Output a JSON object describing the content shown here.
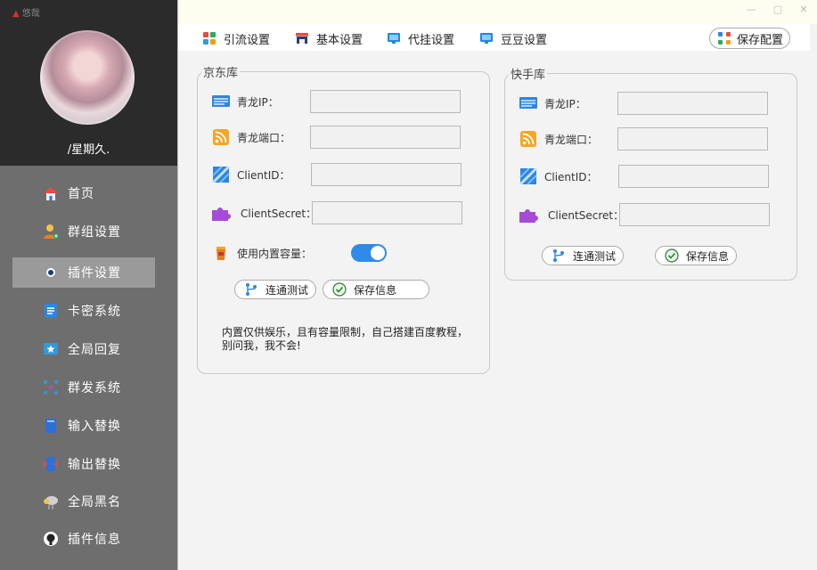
{
  "app": {
    "logo_text": "悠哉"
  },
  "window": {
    "minimize": "—",
    "restore": "▢",
    "close": "✕"
  },
  "profile": {
    "username": "/星期久."
  },
  "sidebar": {
    "items": [
      {
        "label": "首页",
        "icon": "home-icon"
      },
      {
        "label": "群组设置",
        "icon": "group-settings-icon"
      },
      {
        "label": "插件设置",
        "icon": "plugin-settings-icon",
        "active": true
      },
      {
        "label": "卡密系统",
        "icon": "card-key-icon"
      },
      {
        "label": "全局回复",
        "icon": "global-reply-icon"
      },
      {
        "label": "群发系统",
        "icon": "broadcast-icon"
      },
      {
        "label": "输入替换",
        "icon": "input-replace-icon"
      },
      {
        "label": "输出替换",
        "icon": "output-replace-icon"
      },
      {
        "label": "全局黑名",
        "icon": "global-blacklist-icon"
      },
      {
        "label": "插件信息",
        "icon": "github-icon"
      }
    ]
  },
  "tabs": [
    {
      "label": "引流设置",
      "icon": "grid-icon"
    },
    {
      "label": "基本设置",
      "icon": "shop-icon"
    },
    {
      "label": "代挂设置",
      "icon": "monitor-icon"
    },
    {
      "label": "豆豆设置",
      "icon": "monitor-icon"
    }
  ],
  "toolbar": {
    "save_config": "保存配置"
  },
  "jd": {
    "title": "京东库",
    "fields": [
      {
        "label": "青龙IP：",
        "value": ""
      },
      {
        "label": "青龙端口：",
        "value": ""
      },
      {
        "label": "ClientID：",
        "value": ""
      },
      {
        "label": "ClientSecret：",
        "value": ""
      }
    ],
    "builtin_label": "使用内置容量：",
    "builtin_enabled": true,
    "test_button": "连通测试",
    "save_button": "保存信息",
    "note": "内置仅供娱乐，且有容量限制，自己搭建百度教程，别问我，我不会!"
  },
  "ks": {
    "title": "快手库",
    "fields": [
      {
        "label": "青龙IP：",
        "value": ""
      },
      {
        "label": "青龙端口：",
        "value": ""
      },
      {
        "label": "ClientID：",
        "value": ""
      },
      {
        "label": "ClientSecret：",
        "value": ""
      }
    ],
    "test_button": "连通测试",
    "save_button": "保存信息"
  },
  "colors": {
    "sidebar_bg": "#6e6e6e",
    "sidebar_top": "#2b2b2b",
    "accent": "#2f8be8",
    "active_item": "#9a9a9a"
  }
}
